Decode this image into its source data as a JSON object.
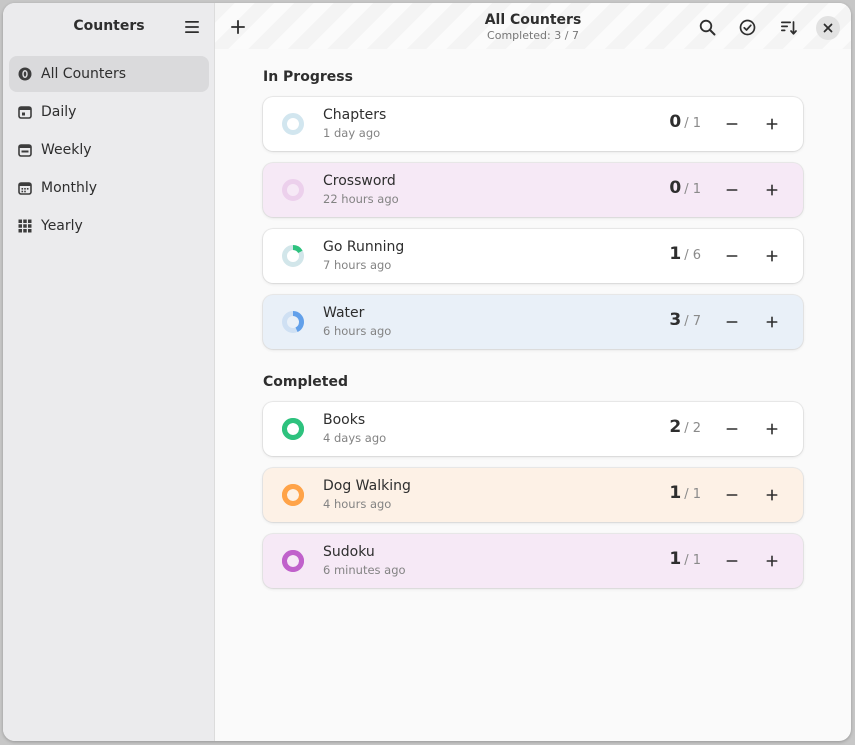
{
  "sidebar": {
    "title": "Counters",
    "items": [
      {
        "label": "All Counters",
        "icon": "zero-badge-icon",
        "active": true
      },
      {
        "label": "Daily",
        "icon": "calendar-day-icon",
        "active": false
      },
      {
        "label": "Weekly",
        "icon": "calendar-week-icon",
        "active": false
      },
      {
        "label": "Monthly",
        "icon": "calendar-month-icon",
        "active": false
      },
      {
        "label": "Yearly",
        "icon": "grid-year-icon",
        "active": false
      }
    ]
  },
  "header": {
    "title": "All Counters",
    "subtitle": "Completed: 3 / 7"
  },
  "sections": {
    "in_progress": "In Progress",
    "completed": "Completed"
  },
  "colors": {
    "accent_teal": "#2ec27e",
    "water_blue": "#62a0ea",
    "orange": "#ffa348",
    "purple": "#c061cb",
    "pink_card": "#f6e9f6",
    "blue_card": "#e9f0f8",
    "orange_card": "#fdf1e6"
  },
  "counters": [
    {
      "name": "Chapters",
      "time": "1 day ago",
      "value": "0",
      "total": "/ 1",
      "progress": 0.0,
      "card": "#ffffff",
      "ring_bg": "#d2e6ef",
      "ring_fg": "#8fc0d8"
    },
    {
      "name": "Crossword",
      "time": "22 hours ago",
      "value": "0",
      "total": "/ 1",
      "progress": 0.0,
      "card": "#f6e9f6",
      "ring_bg": "#ecd0ec",
      "ring_fg": "#d9a6d9"
    },
    {
      "name": "Go Running",
      "time": "7 hours ago",
      "value": "1",
      "total": "/ 6",
      "progress": 0.1667,
      "card": "#ffffff",
      "ring_bg": "#d2e6ea",
      "ring_fg": "#2ec27e"
    },
    {
      "name": "Water",
      "time": "6 hours ago",
      "value": "3",
      "total": "/ 7",
      "progress": 0.4286,
      "card": "#e9f0f8",
      "ring_bg": "#cfe0f3",
      "ring_fg": "#62a0ea"
    },
    {
      "name": "Books",
      "time": "4 days ago",
      "value": "2",
      "total": "/ 2",
      "progress": 1.0,
      "card": "#ffffff",
      "ring_bg": "#2ec27e",
      "ring_fg": "#2ec27e"
    },
    {
      "name": "Dog Walking",
      "time": "4 hours ago",
      "value": "1",
      "total": "/ 1",
      "progress": 1.0,
      "card": "#fdf1e6",
      "ring_bg": "#ffa348",
      "ring_fg": "#ffa348"
    },
    {
      "name": "Sudoku",
      "time": "6 minutes ago",
      "value": "1",
      "total": "/ 1",
      "progress": 1.0,
      "card": "#f6e9f6",
      "ring_bg": "#c061cb",
      "ring_fg": "#c061cb"
    }
  ]
}
